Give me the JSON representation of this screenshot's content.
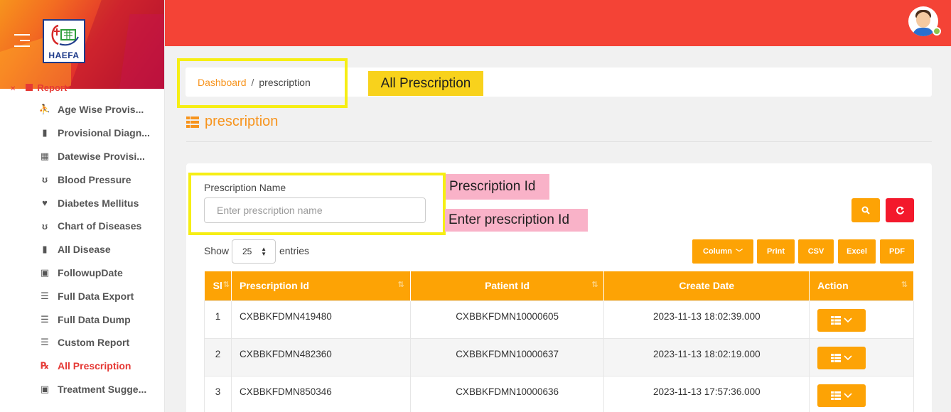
{
  "brand": {
    "logo_text": "HAEFA"
  },
  "sidebar": {
    "partial_item": "Report",
    "items": [
      {
        "label": "Age Wise Provis...",
        "icon": "user-injured-icon"
      },
      {
        "label": "Provisional Diagn...",
        "icon": "scroll-icon"
      },
      {
        "label": "Datewise Provisi...",
        "icon": "calendar-icon"
      },
      {
        "label": "Blood Pressure",
        "icon": "stethoscope-icon"
      },
      {
        "label": "Diabetes Mellitus",
        "icon": "heartbeat-icon"
      },
      {
        "label": "Chart of Diseases",
        "icon": "stethoscope-icon"
      },
      {
        "label": "All Disease",
        "icon": "clipboard-icon"
      },
      {
        "label": "FollowupDate",
        "icon": "hospital-icon"
      },
      {
        "label": "Full Data Export",
        "icon": "list-icon"
      },
      {
        "label": "Full Data Dump",
        "icon": "list-icon"
      },
      {
        "label": "Custom Report",
        "icon": "list-icon"
      },
      {
        "label": "All Prescription",
        "icon": "prescription-icon",
        "active": true
      },
      {
        "label": "Treatment Sugge...",
        "icon": "medkit-icon"
      }
    ]
  },
  "breadcrumb": {
    "home": "Dashboard",
    "separator": "/",
    "current": "prescription"
  },
  "annotations": {
    "all_prescription": "All Prescription",
    "prescription_id": "Prescription Id",
    "enter_prescription_id": "Enter prescription Id"
  },
  "page": {
    "title": "prescription"
  },
  "filter": {
    "label": "Prescription Name",
    "placeholder": "Enter prescription name",
    "value": ""
  },
  "table_controls": {
    "show_label": "Show",
    "entries_value": "25",
    "entries_label": "entries",
    "buttons": [
      "Column",
      "Print",
      "CSV",
      "Excel",
      "PDF"
    ]
  },
  "table": {
    "columns": [
      "Sl",
      "Prescription Id",
      "Patient Id",
      "Create Date",
      "Action"
    ],
    "rows": [
      {
        "sl": "1",
        "prescription_id": "CXBBKFDMN419480",
        "patient_id": "CXBBKFDMN10000605",
        "create_date": "2023-11-13 18:02:39.000"
      },
      {
        "sl": "2",
        "prescription_id": "CXBBKFDMN482360",
        "patient_id": "CXBBKFDMN10000637",
        "create_date": "2023-11-13 18:02:19.000"
      },
      {
        "sl": "3",
        "prescription_id": "CXBBKFDMN850346",
        "patient_id": "CXBBKFDMN10000636",
        "create_date": "2023-11-13 17:57:36.000"
      }
    ]
  },
  "colors": {
    "accent": "#fda305",
    "topbar": "#f44336",
    "danger": "#f3192c",
    "highlight": "#f6ee14",
    "pink_tag": "#f9b2c8"
  }
}
